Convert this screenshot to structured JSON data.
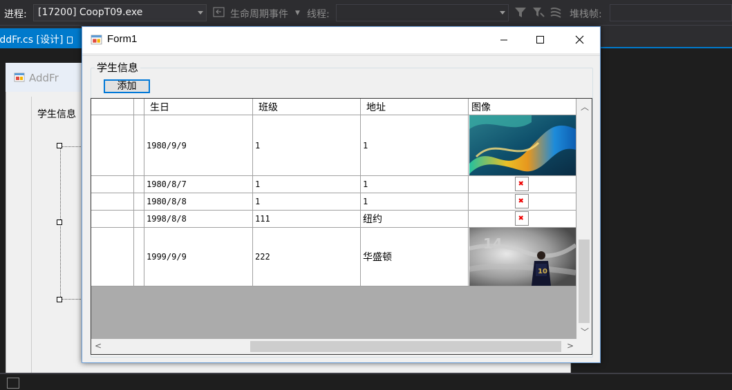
{
  "toolbar": {
    "process_label": "进程:",
    "process_value": "[17200] CoopT09.exe",
    "lifecycle_label": "生命周期事件",
    "thread_label": "线程:",
    "thread_value": "",
    "stackframe_label": "堆栈帧:",
    "stackframe_value": ""
  },
  "tabs": [
    {
      "label": "AddFr.cs [设计]",
      "active": true
    }
  ],
  "designer": {
    "form_title": "AddFr",
    "group_label": "学生信息"
  },
  "window": {
    "title": "Form1",
    "group_label": "学生信息",
    "add_button": "添加"
  },
  "grid": {
    "columns": [
      "",
      "生日",
      "班级",
      "地址",
      "图像"
    ],
    "rows": [
      {
        "birthday": "1980/9/9",
        "class": "1",
        "address": "1",
        "image": "abstract-colorful-wave"
      },
      {
        "birthday": "1980/8/7",
        "class": "1",
        "address": "1",
        "image": "broken-image"
      },
      {
        "birthday": "1980/8/8",
        "class": "1",
        "address": "1",
        "image": "broken-image"
      },
      {
        "birthday": "1998/8/8",
        "class": "111",
        "address": "纽约",
        "image": "broken-image"
      },
      {
        "birthday": "1999/9/9",
        "class": "222",
        "address": "华盛顿",
        "image": "soccer-player-photo"
      }
    ]
  },
  "colors": {
    "vs_background": "#1e1e1e",
    "vs_toolbar": "#2d2d30",
    "vs_accent": "#007acc",
    "form_background": "#f0f0f0",
    "grid_background": "#ababab",
    "button_focus": "#0078d7"
  }
}
